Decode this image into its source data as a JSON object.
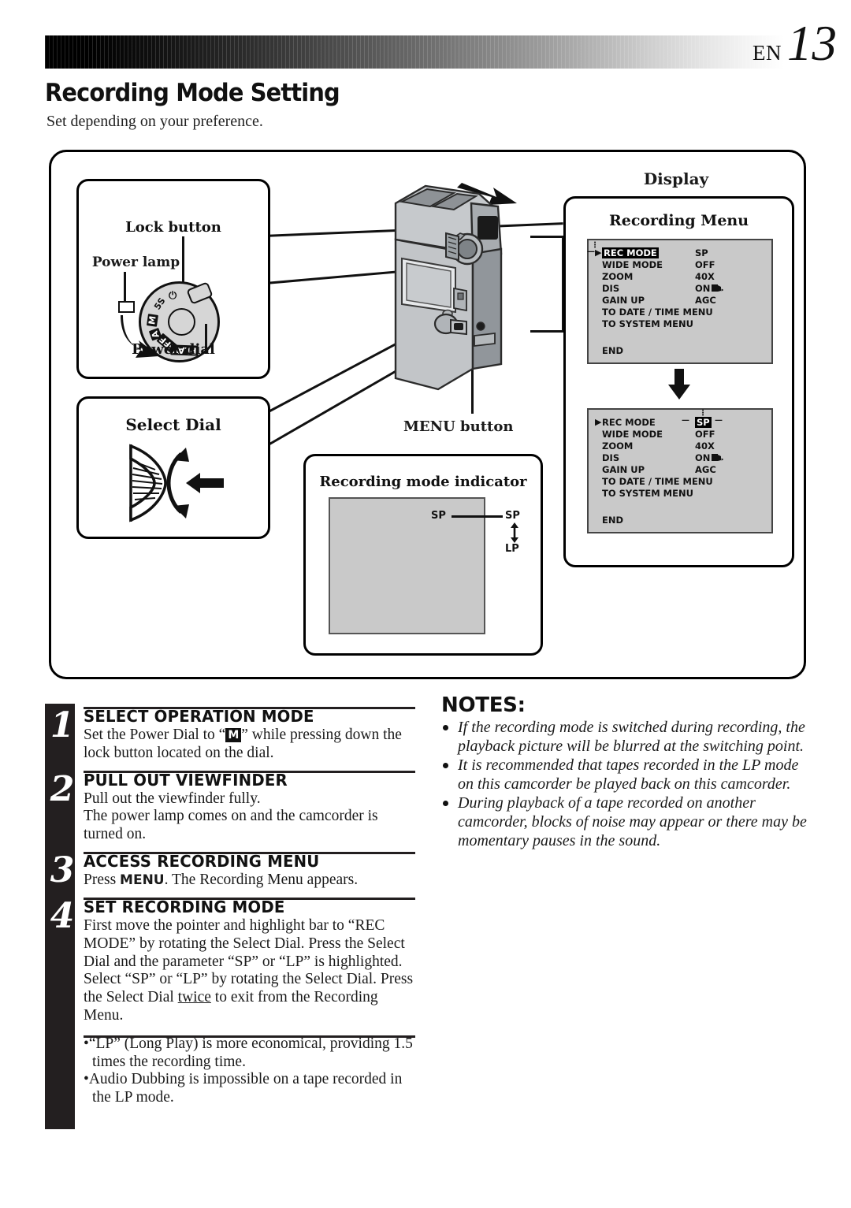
{
  "header": {
    "lang_code": "EN",
    "page_number": "13"
  },
  "page": {
    "title": "Recording Mode Setting",
    "subtitle": "Set depending on your preference."
  },
  "figure": {
    "power_panel": {
      "lock_button_label": "Lock button",
      "power_lamp_label": "Power lamp",
      "power_dial_label": "Power dial",
      "dial_marks": [
        "5S",
        "M",
        "A",
        "OFF",
        "PLAY"
      ],
      "dial_power_symbol": "⏻"
    },
    "select_panel": {
      "title": "Select Dial"
    },
    "menu_button_label": "MENU button",
    "rec_indicator_panel": {
      "title": "Recording mode indicator",
      "screen_label": "SP",
      "callout_top": "SP",
      "callout_bottom": "LP"
    },
    "display_panel": {
      "title": "Display",
      "menu_title": "Recording Menu",
      "osd_screen_1": {
        "pointer_row": 0,
        "highlight": "label",
        "rows": [
          {
            "label": "REC MODE",
            "value": "SP"
          },
          {
            "label": "WIDE MODE",
            "value": "OFF"
          },
          {
            "label": "ZOOM",
            "value": "40X"
          },
          {
            "label": "DIS",
            "value": "ON"
          },
          {
            "label": "GAIN UP",
            "value": "AGC"
          },
          {
            "label": "TO DATE / TIME MENU",
            "value": ""
          },
          {
            "label": "TO SYSTEM MENU",
            "value": ""
          }
        ],
        "end_label": "END"
      },
      "osd_screen_2": {
        "pointer_row": 0,
        "highlight": "value",
        "rows": [
          {
            "label": "REC MODE",
            "value": "SP"
          },
          {
            "label": "WIDE MODE",
            "value": "OFF"
          },
          {
            "label": "ZOOM",
            "value": "40X"
          },
          {
            "label": "DIS",
            "value": "ON"
          },
          {
            "label": "GAIN UP",
            "value": "AGC"
          },
          {
            "label": "TO DATE / TIME MENU",
            "value": ""
          },
          {
            "label": "TO SYSTEM MENU",
            "value": ""
          }
        ],
        "end_label": "END"
      }
    }
  },
  "steps": [
    {
      "number": "1",
      "heading": "SELECT OPERATION MODE",
      "body_pre": "Set the Power Dial to “",
      "body_mark": "M",
      "body_post": "” while pressing down the lock button located on the dial."
    },
    {
      "number": "2",
      "heading": "PULL OUT VIEWFINDER",
      "body": "Pull out the viewfinder fully.\nThe power lamp comes on and the camcorder is turned on."
    },
    {
      "number": "3",
      "heading": "ACCESS RECORDING MENU",
      "body_pre": "Press ",
      "body_bold": "MENU",
      "body_post": ". The Recording Menu appears."
    },
    {
      "number": "4",
      "heading": "SET RECORDING MODE",
      "body_pre": "First move the pointer and highlight bar to “REC MODE” by rotating the Select Dial. Press the Select Dial and the parameter “SP” or “LP” is highlighted. Select “SP” or “LP” by rotating the Select Dial. Press the Select Dial ",
      "body_underline": "twice",
      "body_post": " to exit from the Recording Menu."
    }
  ],
  "tips": [
    "•“LP” (Long Play) is more economical, providing 1.5 times the recording time.",
    "•Audio Dubbing is impossible on a tape recorded in the LP mode."
  ],
  "notes": {
    "title": "NOTES:",
    "items": [
      "If the recording mode is switched during recording, the playback picture will be blurred at the switching point.",
      "It is recommended that tapes recorded in the LP mode on this camcorder be played back on this camcorder.",
      "During playback of a tape recorded on another camcorder, blocks of noise may appear or there may be momentary pauses in the sound."
    ]
  },
  "colors": {
    "ink": "#231f20",
    "osd_background": "#c9c9c9",
    "dial_gray": "#d6d6d6"
  }
}
